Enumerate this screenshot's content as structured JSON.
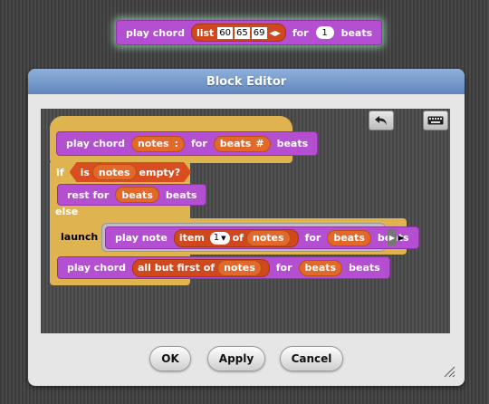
{
  "top_block": {
    "play_chord": "play chord",
    "list": "list",
    "items": [
      "60",
      "65",
      "69"
    ],
    "for": "for",
    "count": "1",
    "beats": "beats"
  },
  "dialog": {
    "title": "Block Editor",
    "buttons": {
      "ok": "OK",
      "apply": "Apply",
      "cancel": "Cancel"
    }
  },
  "script": {
    "hat": {
      "play_chord": "play chord",
      "param1": "notes",
      "param1_marker": ":",
      "for": "for",
      "param2": "beats",
      "param2_marker": "#",
      "beats": "beats"
    },
    "if": {
      "label": "if",
      "is": "is",
      "var": "notes",
      "empty": "empty?"
    },
    "rest": {
      "label": "rest for",
      "var": "beats",
      "beats": "beats"
    },
    "else": "else",
    "launch": {
      "label": "launch",
      "play_note": "play note",
      "item": "item",
      "index": "1",
      "of": "of",
      "notes": "notes",
      "for": "for",
      "beats_var": "beats",
      "beats": "beats"
    },
    "recurse": {
      "play_chord": "play chord",
      "all_but_first_of": "all but first of",
      "notes": "notes",
      "for": "for",
      "beats_var": "beats",
      "beats": "beats"
    }
  },
  "colors": {
    "control": "#e0b351",
    "custom": "#b54fd1",
    "lists": "#d0481e",
    "variables": "#e2692a",
    "titlebar": "#6f94c7"
  },
  "icons": [
    "undo-icon",
    "keyboard-icon",
    "resize-handle-icon"
  ]
}
